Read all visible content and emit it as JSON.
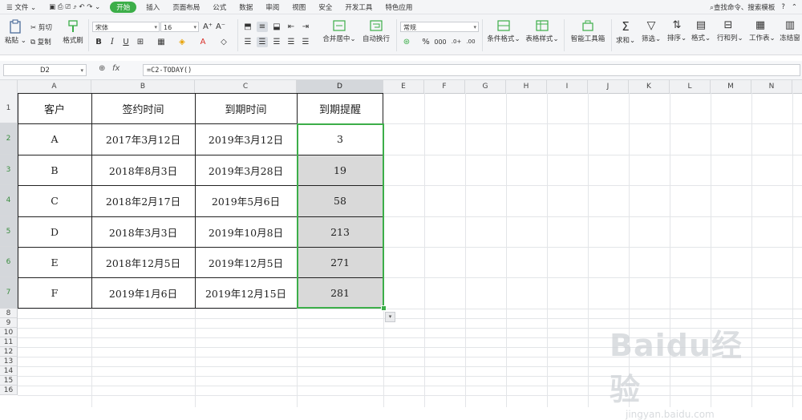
{
  "menubar": {
    "file": "文件",
    "tabs": [
      "开始",
      "插入",
      "页面布局",
      "公式",
      "数据",
      "审阅",
      "视图",
      "安全",
      "开发工具",
      "特色应用"
    ],
    "search": "查找命令、搜索模板",
    "help": "?"
  },
  "ribbon": {
    "paste": "粘贴",
    "cut": "剪切",
    "copy": "复制",
    "format_painter": "格式刷",
    "font_name": "宋体",
    "font_size": "16",
    "merge_center": "合并居中",
    "wrap_text": "自动换行",
    "number_format": "常规",
    "percent": "%",
    "thousands": "000",
    "conditional_format": "条件格式",
    "table_style": "表格样式",
    "smart_toolbox": "智能工具箱",
    "sum": "求和",
    "filter": "筛选",
    "sort": "排序",
    "format": "格式",
    "row_col": "行和列",
    "worksheet": "工作表",
    "freeze": "冻结窗"
  },
  "formula_bar": {
    "name_box": "D2",
    "fx": "fx",
    "formula": "=C2-TODAY()"
  },
  "grid": {
    "columns": [
      "A",
      "B",
      "C",
      "D",
      "E",
      "F",
      "G",
      "H",
      "I",
      "J",
      "K",
      "L",
      "M",
      "N"
    ],
    "rows": [
      "1",
      "2",
      "3",
      "4",
      "5",
      "6",
      "7",
      "8",
      "9",
      "10",
      "11",
      "12",
      "13",
      "14",
      "15",
      "16"
    ],
    "selected_column": "D",
    "table": {
      "headers": [
        "客户",
        "签约时间",
        "到期时间",
        "到期提醒"
      ],
      "rows": [
        [
          "A",
          "2017年3月12日",
          "2019年3月12日",
          "3"
        ],
        [
          "B",
          "2018年8月3日",
          "2019年3月28日",
          "19"
        ],
        [
          "C",
          "2018年2月17日",
          "2019年5月6日",
          "58"
        ],
        [
          "D",
          "2018年3月3日",
          "2019年10月8日",
          "213"
        ],
        [
          "E",
          "2018年12月5日",
          "2019年12月5日",
          "271"
        ],
        [
          "F",
          "2019年1月6日",
          "2019年12月15日",
          "281"
        ]
      ]
    }
  },
  "watermark": {
    "brand": "Baidu经验",
    "url": "jingyan.baidu.com"
  },
  "colors": {
    "accent": "#3cae49",
    "selected_fill": "#d9d9d9"
  }
}
